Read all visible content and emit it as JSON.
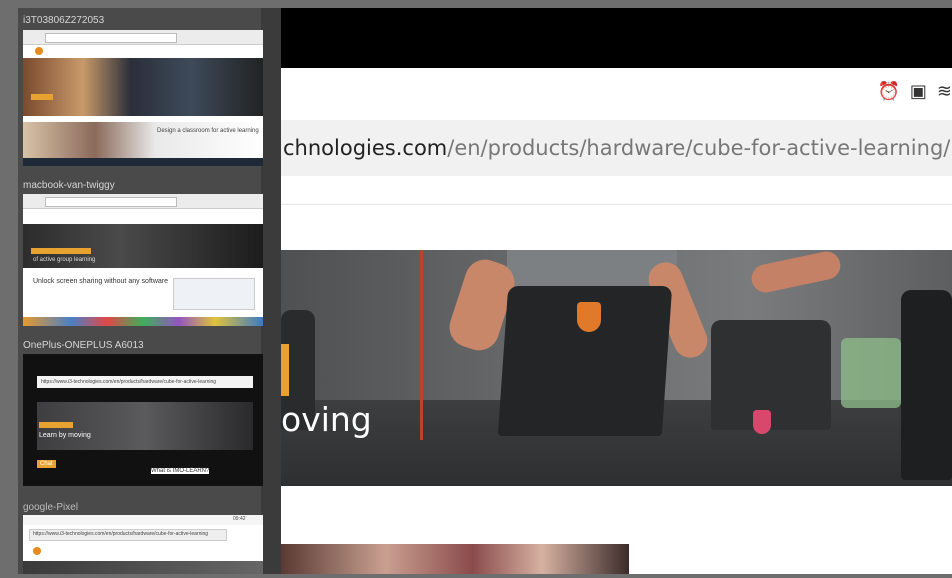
{
  "main_view": {
    "url_host": "chnologies.com",
    "url_path": "/en/products/hardware/cube-for-active-learning/",
    "hero_text": "oving",
    "status_icons": [
      "alarm-icon",
      "nfc-icon",
      "cast-icon"
    ]
  },
  "devices": [
    {
      "label": "i3T03806Z272053",
      "title": "Design a classroom for active learning"
    },
    {
      "label": "macbook-van-twiggy",
      "title": "Unlock screen sharing without any software",
      "banner_text": "of active group learning"
    },
    {
      "label": "OnePlus-ONEPLUS A6013",
      "url": "https://www.i3-technologies.com/en/products/hardware/cube-for-active-learning",
      "hero_text": "Learn by moving",
      "cta": "Chat",
      "heading": "What is IMO-LEARN?"
    },
    {
      "label": "google-Pixel",
      "url": "https://www.i3-technologies.com/en/products/hardware/cube-for-active-learning",
      "status_time": "09:42"
    }
  ],
  "colors": {
    "accent": "#e8a230",
    "brand_orange": "#e88a1e",
    "sidebar_bg": "#4a4a4a",
    "frame_bg": "#6e6e6e"
  }
}
